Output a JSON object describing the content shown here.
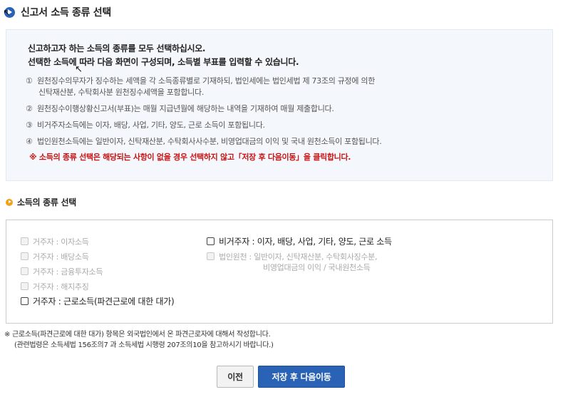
{
  "header": {
    "title": "신고서 소득 종류 선택"
  },
  "info": {
    "lead": "신고하고자 하는 소득의 종류를 모두 선택하십시오.",
    "lead2": "선택한 소득에 따라 다음 화면이 구성되며, 소득별 부표를 입력할 수 있습니다.",
    "items": [
      {
        "num": "①",
        "text": "원천징수의무자가 징수하는 세액을 각 소득종류별로 기재하되, 법인세에는 법인세법 제 73조의 규정에 의한",
        "text2": "신탁재산분, 수탁회사분 원천징수세액을 포함합니다."
      },
      {
        "num": "②",
        "text": "원천징수이행상황신고서(부표)는 매월 지급년월에 해당하는 내역을 기재하여 매월 제출합니다."
      },
      {
        "num": "③",
        "text": "비거주자소득에는 이자, 배당, 사업, 기타, 양도, 근로 소득이 포함됩니다."
      },
      {
        "num": "④",
        "text": "법인원천소득에는 일반이자, 신탁재산분, 수탁회사사수분, 비영업대금의 이익 및 국내 원천소득이 포함됩니다."
      }
    ],
    "warning": "※ 소득의 종류 선택은 해당되는 사항이 없을 경우 선택하지 않고「저장 후 다음이동」을 클릭합니다."
  },
  "section": {
    "title": "소득의 종류 선택"
  },
  "options": {
    "left": [
      {
        "label": "거주자 : 이자소득",
        "enabled": false
      },
      {
        "label": "거주자 : 배당소득",
        "enabled": false
      },
      {
        "label": "거주자 : 금융투자소득",
        "enabled": false
      },
      {
        "label": "거주자 : 해지추징",
        "enabled": false
      },
      {
        "label": "거주자 : 근로소득(파견근로에 대한 대가)",
        "enabled": true
      }
    ],
    "right": [
      {
        "label": "비거주자 : 이자, 배당, 사업, 기타, 양도, 근로 소득",
        "enabled": true
      },
      {
        "label": "법인원천 : 일반이자, 신탁재산분, 수탁회사징수분,",
        "label2": "비영업대금의 이익 / 국내원천소득",
        "enabled": false
      }
    ]
  },
  "footnote": {
    "line1": "※ 근로소득(파견근로에 대한 대가) 항목은 외국법인에서 온 파견근로자에 대해서 작성합니다.",
    "line2": "(관련법령은 소득세법 156조의7 과 소득세법 시행령 207조의10을 참고하시기 바랍니다.)"
  },
  "buttons": {
    "prev": "이전",
    "next": "저장 후 다음이동"
  },
  "colors": {
    "primary": "#2a63b5",
    "warning": "#cc1111",
    "info_bg": "#f4f7fb",
    "section_icon": "#f2a21a"
  }
}
